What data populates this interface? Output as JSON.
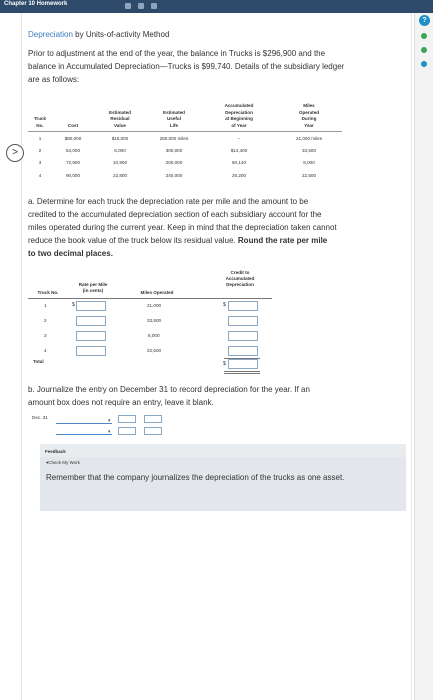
{
  "window": {
    "title": "Chapter 10 Homework"
  },
  "nav": {
    "prev_icon": ">"
  },
  "help": {
    "icon": "?"
  },
  "heading": {
    "link": "Depreciation",
    "rest": " by Units-of-activity Method"
  },
  "intro": {
    "line1": "Prior to adjustment at the end of the year, the balance in Trucks is $296,900 and the",
    "line2": "balance in Accumulated Depreciation—Trucks is $99,740. Details of the subsidiary ledger",
    "line3": "are as follows:"
  },
  "subsidiary": {
    "headers": {
      "truck": [
        "Truck",
        "No."
      ],
      "cost": [
        "",
        "Cost"
      ],
      "residual": [
        "Estimated",
        "Residual",
        "Value"
      ],
      "life": [
        "Estimated",
        "Useful",
        "Life"
      ],
      "accum": [
        "Accumulated",
        "Depreciation",
        "at Beginning",
        "of Year"
      ],
      "miles": [
        "Miles",
        "Operated",
        "During",
        "Year"
      ]
    },
    "rows": [
      {
        "no": "1",
        "cost": "$80,000",
        "residual": "$15,000",
        "life": "250,000 miles",
        "accum": "–",
        "miles": "21,000 miles"
      },
      {
        "no": "2",
        "cost": "54,000",
        "residual": "6,000",
        "life": "300,000",
        "accum": "$14,400",
        "miles": "33,500"
      },
      {
        "no": "3",
        "cost": "72,900",
        "residual": "10,900",
        "life": "200,000",
        "accum": "60,140",
        "miles": "8,000"
      },
      {
        "no": "4",
        "cost": "90,000",
        "residual": "22,800",
        "life": "240,000",
        "accum": "25,200",
        "miles": "22,500"
      }
    ]
  },
  "part_a": {
    "line1": "a.  Determine for each truck the depreciation rate per mile and the amount to be",
    "line2": "credited to the accumulated depreciation section of each subsidiary account for the",
    "line3": "miles operated during the current year. Keep in mind that the depreciation taken cannot",
    "line4_plain": "reduce the book value of the truck below its residual value. ",
    "line4_bold": "Round the rate per mile",
    "line5_bold": "to two decimal places.",
    "table": {
      "col_truck": "Truck No.",
      "col_rate_1": "Rate per Mile",
      "col_rate_2": "(in cents)",
      "col_miles": "Miles Operated",
      "col_credit_1": "Credit to",
      "col_credit_2": "Accumulated",
      "col_credit_3": "Depreciation",
      "rows": [
        {
          "no": "1",
          "miles": "21,000"
        },
        {
          "no": "2",
          "miles": "33,500"
        },
        {
          "no": "3",
          "miles": "8,000"
        },
        {
          "no": "4",
          "miles": "22,500"
        }
      ],
      "total_label": "Total",
      "dollar": "$"
    }
  },
  "part_b": {
    "line1": "b.  Journalize the entry on December 31 to record depreciation for the year. If an",
    "line2": "amount box does not require an entry, leave it blank.",
    "date": "Dec. 31"
  },
  "feedback": {
    "label": "Feedback",
    "check": "▾Check My Work",
    "message": "Remember that the company journalizes the depreciation of the trucks as one asset."
  },
  "colors": {
    "link": "#3d7dbf",
    "header_bar": "#2e4a6b",
    "feedback_bg": "#e9ecef"
  }
}
